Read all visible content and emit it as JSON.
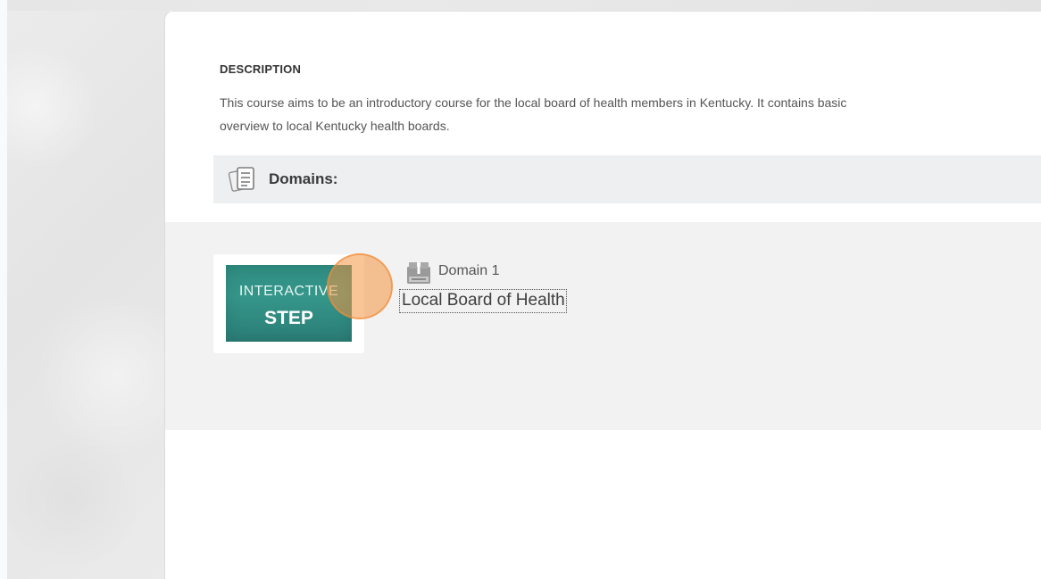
{
  "description": {
    "heading": "DESCRIPTION",
    "text": "This course aims to be an introductory course for the local board of health members in Kentucky. It contains basic\noverview to local Kentucky health boards."
  },
  "domains": {
    "title": "Domains:",
    "items": [
      {
        "subtitle": "Domain 1",
        "link_label": "Local Board of Health",
        "thumbnail": {
          "line1": "INTERACTIVE",
          "line2": "STEP"
        }
      }
    ]
  },
  "icons": {
    "domains_header_icon": "document-list-icon",
    "domain_item_icon": "scorm-package-icon"
  },
  "colors": {
    "thumbnail_teal": "#2f8d83",
    "click_marker": "#f49642",
    "header_band": "#eeeff1",
    "content_band": "#f2f2f2"
  }
}
